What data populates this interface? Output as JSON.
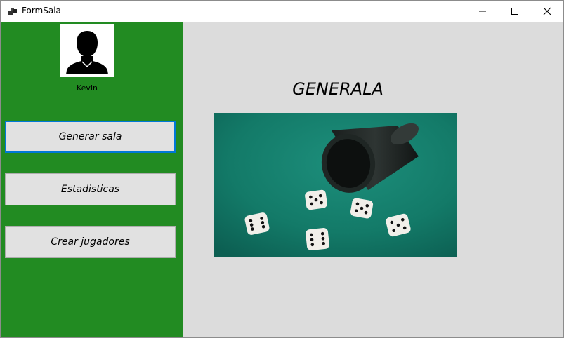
{
  "window": {
    "title": "FormSala",
    "icons": {
      "app": "windows-form-icon",
      "minimize": "minimize-icon",
      "maximize": "maximize-icon",
      "close": "close-icon"
    }
  },
  "sidebar": {
    "background_color": "#228b22",
    "user": {
      "avatar_icon": "person-silhouette-icon",
      "name": "Kevin"
    },
    "buttons": [
      {
        "label": "Generar sala",
        "focused": true
      },
      {
        "label": "Estadisticas"
      },
      {
        "label": "Crear jugadores"
      }
    ]
  },
  "main": {
    "title": "GENERALA",
    "image": "dice-cup-on-green-felt"
  }
}
